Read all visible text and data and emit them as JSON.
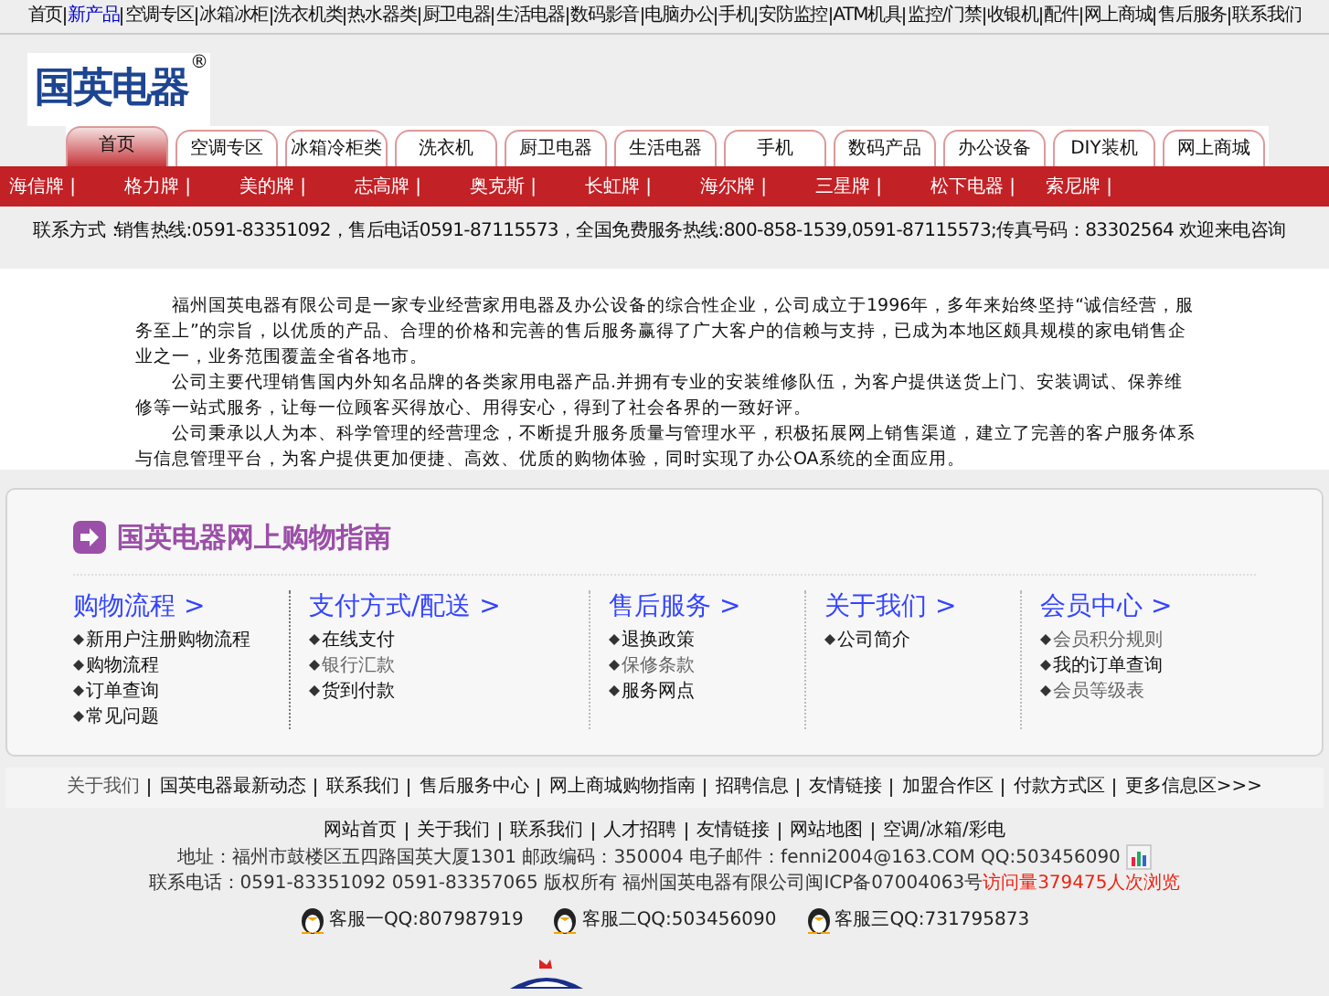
{
  "top_nav": [
    {
      "label": "首页",
      "selected": false
    },
    {
      "label": "新产品",
      "selected": true
    },
    {
      "label": "空调专区",
      "selected": false
    },
    {
      "label": "冰箱冰柜",
      "selected": false
    },
    {
      "label": "洗衣机类",
      "selected": false
    },
    {
      "label": "热水器类",
      "selected": false
    },
    {
      "label": "厨卫电器",
      "selected": false
    },
    {
      "label": "生活电器",
      "selected": false
    },
    {
      "label": "数码影音",
      "selected": false
    },
    {
      "label": "电脑办公",
      "selected": false
    },
    {
      "label": "手机",
      "selected": false
    },
    {
      "label": "安防监控",
      "selected": false
    },
    {
      "label": "ATM机具",
      "selected": false
    },
    {
      "label": "监控/门禁",
      "selected": false
    },
    {
      "label": "收银机",
      "selected": false
    },
    {
      "label": "配件",
      "selected": false
    },
    {
      "label": "网上商城",
      "selected": false
    },
    {
      "label": "售后服务",
      "selected": false
    },
    {
      "label": "联系我们",
      "selected": false
    }
  ],
  "logo": {
    "text": "国英电器",
    "mark": "®"
  },
  "tabs": [
    {
      "label": "首页",
      "selected": true
    },
    {
      "label": "空调专区",
      "selected": false
    },
    {
      "label": "冰箱冷柜类",
      "selected": false
    },
    {
      "label": "洗衣机",
      "selected": false
    },
    {
      "label": "厨卫电器",
      "selected": false
    },
    {
      "label": "生活电器",
      "selected": false
    },
    {
      "label": "手机",
      "selected": false
    },
    {
      "label": "数码产品",
      "selected": false
    },
    {
      "label": "办公设备",
      "selected": false
    },
    {
      "label": "DIY装机",
      "selected": false
    },
    {
      "label": "网上商城",
      "selected": false
    }
  ],
  "sub_nav": [
    "海信牌 |",
    "格力牌 |",
    "美的牌 |",
    "志高牌 |",
    "奥克斯 |",
    "长虹牌 |",
    "海尔牌 |",
    "三星牌 |",
    "松下电器 |",
    "索尼牌 |"
  ],
  "notice": {
    "label": "联系方式：",
    "text": "销售热线:0591-83351092，售后电话0591-87115573，全国免费服务热线:800-858-1539,0591-87115573;传真号码：83302564 欢迎来电咨询"
  },
  "intro": [
    "福州国英电器有限公司是一家专业经营家用电器及办公设备的综合性企业，公司成立于1996年，多年来始终坚持“诚信经营，服务至上”的宗旨，以优质的产品、合理的价格和完善的售后服务赢得了广大客户的信赖与支持，已成为本地区颇具规模的家电销售企业之一，业务范围覆盖全省各地市。",
    "公司主要代理销售国内外知名品牌的各类家用电器产品.并拥有专业的安装维修队伍，为客户提供送货上门、安装调试、保养维修等一站式服务，让每一位顾客买得放心、用得安心，得到了社会各界的一致好评。",
    "公司秉承以人为本、科学管理的经营理念，不断提升服务质量与管理水平，积极拓展网上销售渠道，建立了完善的客户服务体系与信息管理平台，为客户提供更加便捷、高效、优质的购物体验，同时实现了办公OA系统的全面应用。"
  ],
  "guide": {
    "title": "国英电器网上购物指南",
    "columns": [
      {
        "heading": "购物流程 >",
        "items": [
          {
            "label": "新用户注册购物流程",
            "dimmed": false
          },
          {
            "label": "购物流程",
            "dimmed": false
          },
          {
            "label": "订单查询",
            "dimmed": false
          },
          {
            "label": "常见问题",
            "dimmed": false
          }
        ]
      },
      {
        "heading": "支付方式/配送 >",
        "items": [
          {
            "label": "在线支付",
            "dimmed": false
          },
          {
            "label": "银行汇款",
            "dimmed": true
          },
          {
            "label": "货到付款",
            "dimmed": false
          }
        ]
      },
      {
        "heading": "售后服务 >",
        "items": [
          {
            "label": "退换政策",
            "dimmed": false
          },
          {
            "label": "保修条款",
            "dimmed": true
          },
          {
            "label": "服务网点",
            "dimmed": false
          }
        ]
      },
      {
        "heading": "关于我们 >",
        "items": [
          {
            "label": "公司简介",
            "dimmed": false
          }
        ]
      },
      {
        "heading": "会员中心 >",
        "items": [
          {
            "label": "会员积分规则",
            "dimmed": true
          },
          {
            "label": "我的订单查询",
            "dimmed": false
          },
          {
            "label": "会员等级表",
            "dimmed": true
          }
        ]
      }
    ]
  },
  "footer_links": [
    {
      "label": "关于我们",
      "dimmed": true
    },
    {
      "label": "国英电器最新动态",
      "dimmed": false
    },
    {
      "label": "联系我们",
      "dimmed": false
    },
    {
      "label": "售后服务中心",
      "dimmed": false
    },
    {
      "label": "网上商城购物指南",
      "dimmed": false
    },
    {
      "label": "招聘信息",
      "dimmed": false
    },
    {
      "label": "友情链接",
      "dimmed": false
    },
    {
      "label": "加盟合作区",
      "dimmed": false
    },
    {
      "label": "付款方式区",
      "dimmed": false
    },
    {
      "label": "更多信息区>>>",
      "dimmed": false
    }
  ],
  "bottom_links": [
    "网站首页",
    "关于我们",
    "联系我们",
    "人才招聘",
    "友情链接",
    "网站地图",
    "空调/冰箱/彩电"
  ],
  "address": "地址：福州市鼓楼区五四路国英大厦1301 邮政编码：350004 电子邮件：fenni2004@163.COM QQ:503456090",
  "contact": "联系电话：0591-83351092 0591-83357065 版权所有 福州国英电器有限公司闽ICP备07004063号",
  "counter": "访问量379475人次浏览",
  "qq": [
    "客服一QQ:807987919",
    "客服二QQ:503456090",
    "客服三QQ:731795873"
  ]
}
